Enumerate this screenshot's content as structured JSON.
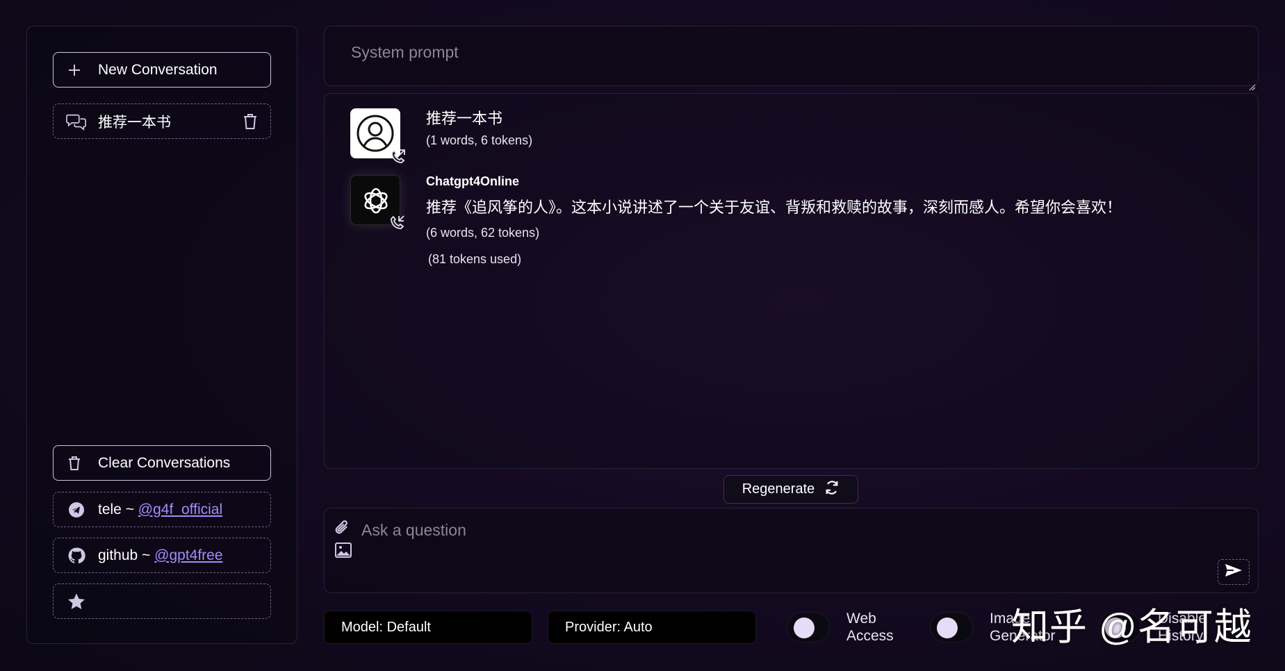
{
  "sidebar": {
    "new_conversation": "New Conversation",
    "conversations": [
      {
        "title": "推荐一本书"
      }
    ],
    "clear_conversations": "Clear Conversations",
    "tele_prefix": "tele ~ ",
    "tele_handle": "@g4f_official",
    "github_prefix": "github ~ ",
    "github_handle": "@gpt4free"
  },
  "system_prompt": {
    "placeholder": "System prompt"
  },
  "chat": {
    "messages": [
      {
        "role": "user",
        "text": "推荐一本书",
        "meta": "(1 words, 6 tokens)"
      },
      {
        "role": "assistant",
        "author": "Chatgpt4Online",
        "text": "推荐《追风筝的人》。这本小说讲述了一个关于友谊、背叛和救赎的故事，深刻而感人。希望你会喜欢！",
        "meta": "(6 words, 62 tokens)",
        "usage": "(81 tokens used)"
      }
    ]
  },
  "regenerate_label": "Regenerate",
  "input": {
    "placeholder": "Ask a question"
  },
  "controls": {
    "model": "Model: Default",
    "provider": "Provider: Auto",
    "toggles": [
      {
        "line1": "Web",
        "line2": "Access"
      },
      {
        "line1": "Image",
        "line2": "Generator"
      },
      {
        "line1": "Disable",
        "line2": "History"
      }
    ]
  },
  "watermark": "知乎 @名可越",
  "colors": {
    "accent": "#a78bfa",
    "knob": "#e7dcf7",
    "border": "#cfc7e4"
  }
}
